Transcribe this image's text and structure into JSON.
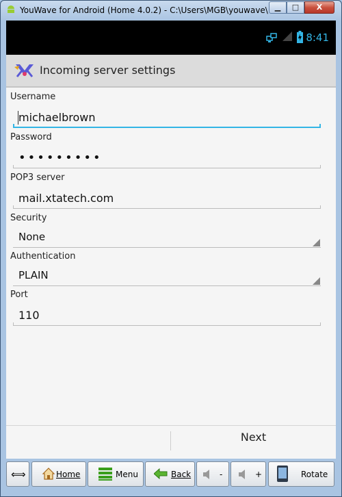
{
  "window": {
    "title": "YouWave for Android (Home 4.0.2) - C:\\Users\\MGB\\youwave\\",
    "controls": {
      "minimize": "▁",
      "maximize": "□",
      "close": "X"
    }
  },
  "statusbar": {
    "clock": "8:41",
    "accent": "#33b5e5"
  },
  "actionbar": {
    "title": "Incoming server settings"
  },
  "form": {
    "username": {
      "label": "Username",
      "value": "michaelbrown"
    },
    "password": {
      "label": "Password",
      "value": "•••••••••"
    },
    "pop3": {
      "label": "POP3 server",
      "value": "mail.xtatech.com"
    },
    "security": {
      "label": "Security",
      "value": "None"
    },
    "authentication": {
      "label": "Authentication",
      "value": "PLAIN"
    },
    "port": {
      "label": "Port",
      "value": "110"
    }
  },
  "bottom": {
    "next": "Next"
  },
  "toolbar": {
    "arrows": "⟺",
    "home": "Home",
    "menu": "Menu",
    "back": "Back",
    "vol_down": "-",
    "vol_up": "+",
    "rotate": "Rotate"
  }
}
